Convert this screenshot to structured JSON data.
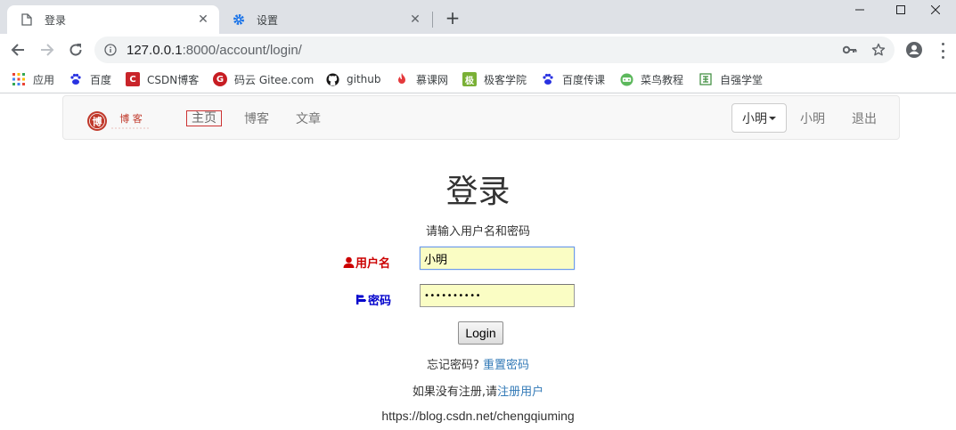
{
  "browser": {
    "tabs": [
      {
        "title": "登录",
        "icon": "page-icon",
        "active": true
      },
      {
        "title": "设置",
        "icon": "gear-icon",
        "active": false
      }
    ],
    "url_host": "127.0.0.1",
    "url_rest": ":8000/account/login/",
    "bookmarks": [
      {
        "label": "应用",
        "icon": "apps-grid-icon"
      },
      {
        "label": "百度",
        "icon": "baidu-paw-icon"
      },
      {
        "label": "CSDN博客",
        "icon": "csdn-icon"
      },
      {
        "label": "码云 Gitee.com",
        "icon": "gitee-icon"
      },
      {
        "label": "github",
        "icon": "github-icon"
      },
      {
        "label": "慕课网",
        "icon": "imooc-flame-icon"
      },
      {
        "label": "极客学院",
        "icon": "jikexueyuan-icon"
      },
      {
        "label": "百度传课",
        "icon": "baidu-paw-icon"
      },
      {
        "label": "菜鸟教程",
        "icon": "runoob-icon"
      },
      {
        "label": "自强学堂",
        "icon": "ziqiang-icon"
      }
    ],
    "accent": "#1a73e8"
  },
  "site_nav": {
    "logo_text": "博 客",
    "links": [
      "主页",
      "博客",
      "文章"
    ],
    "user_dropdown": "小明",
    "user_name": "小明",
    "logout": "退出"
  },
  "login": {
    "title": "登录",
    "subtitle": "请输入用户名和密码",
    "username_label": "用户名",
    "username_value": "小明",
    "password_label": "密码",
    "password_value": "••••••••••",
    "button": "Login",
    "forgot_text": "忘记密码?",
    "reset_link": "重置密码",
    "register_text": "如果没有注册,请",
    "register_link": "注册用户",
    "label_color_user": "#cc0000",
    "label_color_pass": "#0000cc"
  },
  "watermark": "https://blog.csdn.net/chengqiuming"
}
